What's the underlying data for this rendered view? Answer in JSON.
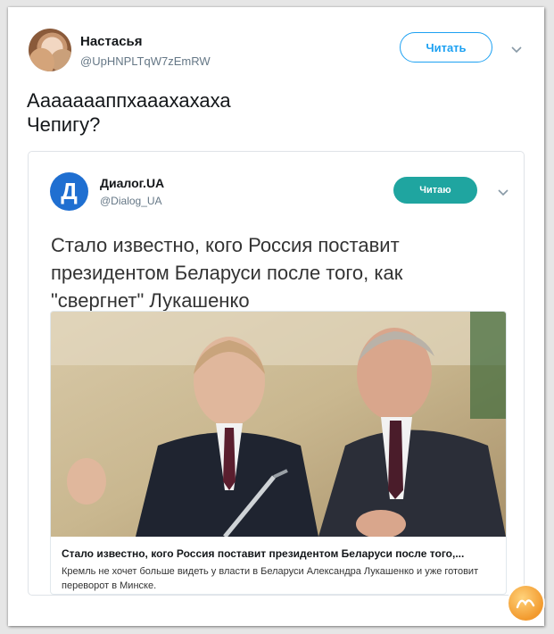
{
  "tweet": {
    "author_name": "Настасья",
    "author_handle": "@UpHNPLTqW7zEmRW",
    "follow_label": "Читать",
    "text_lines": [
      "Аааааааппхааахахаха",
      "Чепигу?"
    ]
  },
  "quoted": {
    "avatar_letter": "Д",
    "author_name": "Диалог.UA",
    "author_handle": "@Dialog_UA",
    "follow_label": "Читаю",
    "headline_lines": [
      "Стало известно, кого Россия поставит",
      "президентом Беларуси после того, как",
      "\"свергнет\" Лукашенко"
    ],
    "card": {
      "title": "Стало известно, кого Россия поставит президентом Беларуси после того,...",
      "description": "Кремль не хочет больше видеть у власти в Беларуси Александра Лукашенко и уже готовит переворот в Минске."
    }
  },
  "colors": {
    "accent": "#1da1f2",
    "follow_filled": "#1fa5a0",
    "quoted_avatar": "#1f6fd1"
  },
  "icons": {
    "tweet_menu": "chevron-down-icon",
    "quoted_menu": "chevron-down-icon",
    "watermark": "logo-badge"
  }
}
